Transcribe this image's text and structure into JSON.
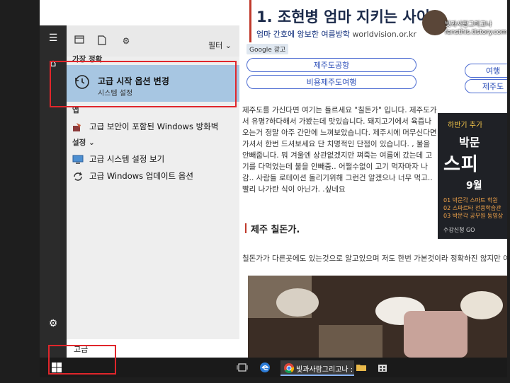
{
  "web": {
    "title": "1. 조현병 엄마 지키는 사",
    "title_tail": "이",
    "ad_text": "엄마 간호에 앙보한 여름방학",
    "ad_url": "worldvision.or.kr",
    "google_ad": "Google 광고",
    "pills": [
      "제주도공항",
      "비용제주도여행",
      "여행",
      "제주도"
    ],
    "body": "제주도를 가신다면 여기는 들르세요 \"칠돈가\" 입니다.  제주도가서 유명?하다해서 가봤는데 맛있습니다. 돼지고기에서 육즙나오는거 정말 아주 간만에 느껴보았습니다. 제주시에 머무신다면 가셔서 한번 드셔보세요 단 치명적인 단점이 있습니다. , 불을 안빼줍니다. 뭐 겨울엔 상관없겠지만  쪄죽는 여름에 갔는데 고기를 다먹었는데 불을 안빼줌.. 어쩔수없이 고기 먹자마자 나감.. 사람들 로테이션 돌리기위해 그런건 알겠으나  너무 먹고.. 빨리 나가란 식이 아닌가. .싶네요",
    "section_title": "제주 칠돈가.",
    "body2": "칠돈가가 다른곳에도 있는것으로 알고있으며 저도 한번 가본것이라 정확하진 않지만 여기가",
    "avatar_text": "빛과사람그리고나\nfansthis.tistory.com",
    "side_ad": {
      "line1": "하반기 추가",
      "line2": "박문",
      "line3": "스피",
      "line4": "9월",
      "line5": "01 박문각 스마트 학원\n02 스파르타 전용학습관\n03 박문각 공무원 동영상",
      "line6": "수강신청 GO"
    }
  },
  "start_menu": {
    "filter_label": "필터",
    "best_match_header": "가장 정확",
    "best_match": {
      "title": "고급 시작 옵션 변경",
      "subtitle": "시스템 설정"
    },
    "apps_header": "앱",
    "app_item": "고급 보안이 포함된 Windows 방화벽",
    "settings_header": "설정",
    "settings_items": [
      "고급 시스템 설정 보기",
      "고급 Windows 업데이트 옵션"
    ],
    "search_query": "고급"
  },
  "taskbar": {
    "chrome_label": "빛과사람그리고나 :"
  },
  "colors": {
    "highlight": "#a7c6e2",
    "annotation_red": "#e0262b",
    "taskbar": "#1a1a1a"
  }
}
